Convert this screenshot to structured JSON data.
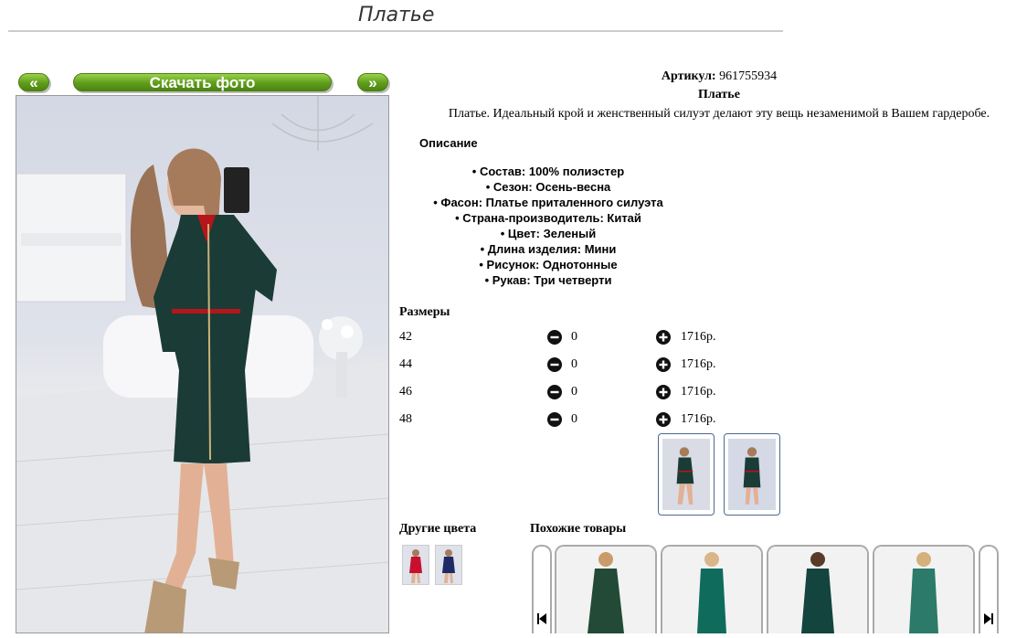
{
  "page": {
    "title": "Платье"
  },
  "gallery": {
    "prev_label": "«",
    "download_label": "Скачать фото",
    "next_label": "»"
  },
  "product": {
    "article_label": "Артикул:",
    "article_value": "961755934",
    "name": "Платье",
    "short_description": "Платье. Идеальный крой и женственный силуэт делают эту вещь незаменимой в Вашем гардеробе."
  },
  "description": {
    "heading": "Описание",
    "items": [
      "• Состав: 100% полиэстер",
      "• Сезон: Осень-весна",
      "• Фасон: Платье приталенного силуэта",
      "• Страна-производитель: Китай",
      "• Цвет: Зеленый",
      "• Длина изделия: Мини",
      "• Рисунок: Однотонные",
      "• Рукав: Три четверти"
    ]
  },
  "sizes": {
    "heading": "Размеры",
    "rows": [
      {
        "size": "42",
        "qty": "0",
        "price": "1716р."
      },
      {
        "size": "44",
        "qty": "0",
        "price": "1716р."
      },
      {
        "size": "46",
        "qty": "0",
        "price": "1716р."
      },
      {
        "size": "48",
        "qty": "0",
        "price": "1716р."
      }
    ]
  },
  "other_colors": {
    "heading": "Другие цвета",
    "swatches": [
      "#c8102e",
      "#1d2a66"
    ]
  },
  "similar": {
    "heading": "Похожие товары"
  },
  "colors": {
    "button_green": "#5f9d1c",
    "dress_green": "#1b3b36",
    "thumb_border": "#4b6a8f"
  }
}
